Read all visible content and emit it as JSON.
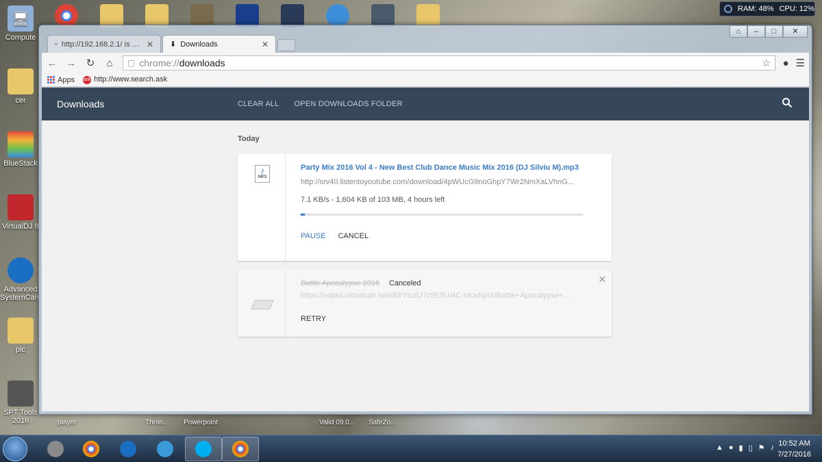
{
  "desktop": {
    "icons": [
      {
        "label": "Compute"
      },
      {
        "label": "cer"
      },
      {
        "label": "BlueStack"
      },
      {
        "label": "VirtualDJ 8"
      },
      {
        "label": "Advanced SystemCare"
      },
      {
        "label": "pic"
      },
      {
        "label": "SPT Tools 2016"
      }
    ],
    "under_labels": [
      "player",
      "Thron...",
      "Powerpoint",
      "Valid 09.0...",
      "SafeZo..."
    ]
  },
  "sysmon": {
    "ram": "RAM: 48%",
    "cpu": "CPU: 12%"
  },
  "browser": {
    "tabs": [
      {
        "label": "http://192.168.2.1/ is not a"
      },
      {
        "label": "Downloads"
      }
    ],
    "address": {
      "scheme": "chrome://",
      "path": "downloads"
    },
    "bookmarks": {
      "apps": "Apps",
      "ask": "http://www.search.ask"
    }
  },
  "downloads": {
    "title": "Downloads",
    "clear_all": "CLEAR ALL",
    "open_folder": "OPEN DOWNLOADS FOLDER",
    "section": "Today",
    "items": [
      {
        "name": "Party Mix 2016 Vol 4 - New Best Club Dance Music Mix 2016 (DJ Silviu M).mp3",
        "url": "http://srv40.listentoyoutube.com/download/4pWUcG9noGhpY7Wr2NmXaLVhnG...",
        "status": "7.1 KB/s - 1,604 KB of 103 MB, 4 hours left",
        "progress": 0.0156,
        "pause": "PAUSE",
        "cancel": "CANCEL",
        "file_badge": "MP3"
      },
      {
        "name": "Battle Apocalypse 2016",
        "state": "Canceled",
        "url": "https://oqbkil.oloadcdn.net/dl/l/Ysz6J7c9E5U/4C-nKwNjXk/Battle+Apocalypse+...",
        "retry": "RETRY"
      }
    ]
  },
  "taskbar": {
    "time": "10:52 AM",
    "date": "7/27/2016"
  },
  "colors": {
    "header": "#37475a",
    "accent": "#3a7bc8"
  }
}
